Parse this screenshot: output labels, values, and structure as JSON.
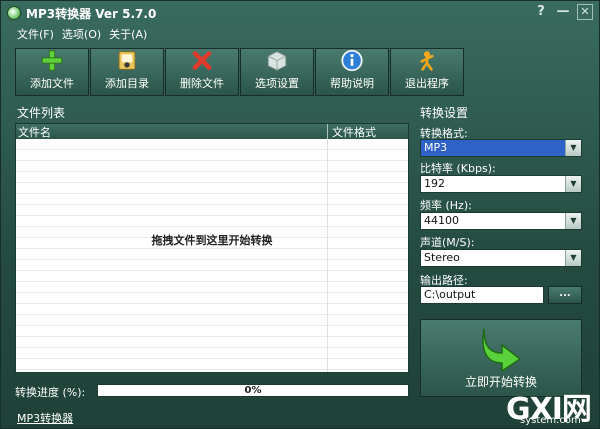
{
  "window": {
    "title": "MP3转换器 Ver 5.7.0",
    "help_glyph": "?",
    "minimize_glyph": "—",
    "close_glyph": "✕"
  },
  "menu": [
    {
      "label": "文件(F)"
    },
    {
      "label": "选项(O)"
    },
    {
      "label": "关于(A)"
    }
  ],
  "toolbar": [
    {
      "label": "添加文件",
      "icon": "plus-icon"
    },
    {
      "label": "添加目录",
      "icon": "folder-icon"
    },
    {
      "label": "删除文件",
      "icon": "delete-icon"
    },
    {
      "label": "选项设置",
      "icon": "settings-box-icon"
    },
    {
      "label": "帮助说明",
      "icon": "info-icon"
    },
    {
      "label": "退出程序",
      "icon": "exit-icon"
    }
  ],
  "file_list": {
    "title": "文件列表",
    "columns": [
      "文件名",
      "文件格式"
    ],
    "empty_hint": "拖拽文件到这里开始转换"
  },
  "progress": {
    "label": "转换进度 (%):",
    "value": 0,
    "text": "0%"
  },
  "footer_link": "MP3转换器",
  "settings": {
    "title": "转换设置",
    "format_label": "转换格式:",
    "format_value": "MP3",
    "bitrate_label": "比特率 (Kbps):",
    "bitrate_value": "192",
    "frequency_label": "频率 (Hz):",
    "frequency_value": "44100",
    "channel_label": "声道(M/S):",
    "channel_value": "Stereo",
    "output_label": "输出路径:",
    "output_value": "C:\\output",
    "browse_label": "...",
    "convert_label": "立即开始转换"
  },
  "watermark": {
    "main": "GXI网",
    "sub": "system.com"
  },
  "colors": {
    "accent_selected": "#2f62c8",
    "window_bg": "#2d5a4e"
  }
}
